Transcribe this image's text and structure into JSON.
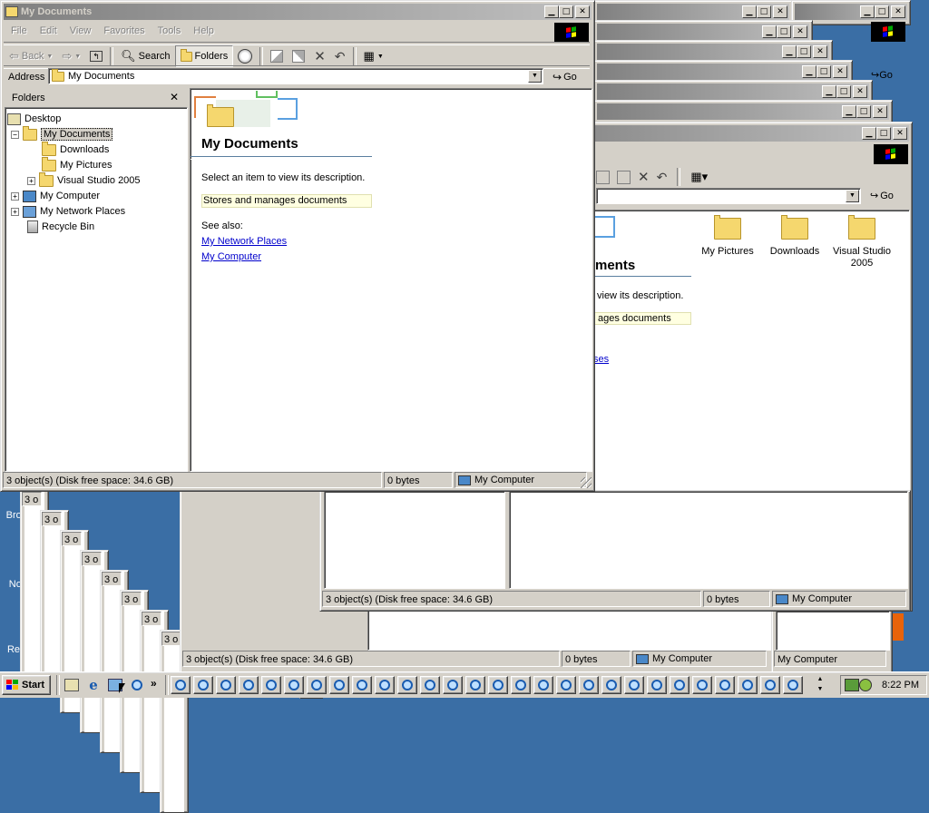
{
  "desktop": {
    "icons": [
      {
        "label": "Browse"
      },
      {
        "label": "Notepad++"
      },
      {
        "label": "Recycle Bin"
      }
    ]
  },
  "main_window": {
    "title": "My Documents",
    "menu": [
      "File",
      "Edit",
      "View",
      "Favorites",
      "Tools",
      "Help"
    ],
    "toolbar": {
      "back": "Back",
      "search": "Search",
      "folders": "Folders"
    },
    "address_label": "Address",
    "address_value": "My Documents",
    "go": "Go",
    "folders_pane_title": "Folders",
    "tree": [
      {
        "label": "Desktop",
        "level": 0
      },
      {
        "label": "My Documents",
        "level": 1,
        "selected": true
      },
      {
        "label": "Downloads",
        "level": 2
      },
      {
        "label": "My Pictures",
        "level": 2
      },
      {
        "label": "Visual Studio 2005",
        "level": 2
      },
      {
        "label": "My Computer",
        "level": 1
      },
      {
        "label": "My Network Places",
        "level": 1
      },
      {
        "label": "Recycle Bin",
        "level": 1
      }
    ],
    "info": {
      "heading": "My Documents",
      "select_text": "Select an item to view its description.",
      "description": "Stores and manages documents",
      "see_also": "See also:",
      "links": [
        "My Network Places",
        "My Computer"
      ]
    },
    "status": {
      "objects": "3 object(s) (Disk free space: 34.6 GB)",
      "size": "0 bytes",
      "location": "My Computer"
    }
  },
  "second_window": {
    "go": "Go",
    "heading_partial": "ments",
    "select_partial": "view its description.",
    "desc_partial": "ages documents",
    "link_partial": "ses",
    "files": [
      "My Pictures",
      "Downloads",
      "Visual Studio 2005"
    ],
    "status": {
      "objects": "3 object(s) (Disk free space: 34.6 GB)",
      "size": "0 bytes",
      "location": "My Computer"
    }
  },
  "bottom_window": {
    "status": {
      "objects": "3 object(s) (Disk free space: 34.6 GB)",
      "size": "0 bytes",
      "location": "My Computer"
    }
  },
  "cascade_status_fragment": "3 o",
  "far_status_location": "My Computer",
  "second_go": "Go",
  "taskbar": {
    "start": "Start",
    "chevron": "»",
    "clock": "8:22 PM"
  }
}
